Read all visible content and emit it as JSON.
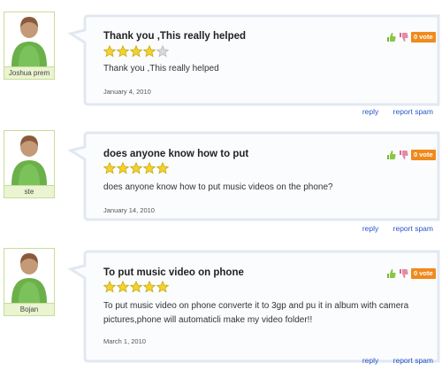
{
  "reviews": [
    {
      "author": "Joshua prem",
      "title": "Thank you ,This really helped",
      "rating": 4,
      "max_rating": 5,
      "body": "Thank you ,This really helped",
      "date": "January 4, 2010",
      "votes": "0 vote"
    },
    {
      "author": "ste",
      "title": "does anyone know how to put",
      "rating": 5,
      "max_rating": 5,
      "body": "does anyone know how to put music videos on the phone?",
      "date": "January 14, 2010",
      "votes": "0 vote"
    },
    {
      "author": "Bojan",
      "title": "To put music video on phone",
      "rating": 5,
      "max_rating": 5,
      "body": "To put music video on phone converte it to 3gp and pu it in album with camera pictures,phone will automaticli make my video folder!!",
      "date": "March 1, 2010",
      "votes": "0 vote"
    }
  ],
  "actions": {
    "reply_label": "reply",
    "spam_label": "report spam"
  },
  "colors": {
    "star_filled": "#f2d22e",
    "star_empty": "#d9d9d9",
    "vote_badge": "#f08a1c",
    "link": "#2a55c8",
    "avatar_border": "#c8dc9a",
    "thumb_up": "#7bb33a",
    "thumb_down": "#d96a8a"
  },
  "icons": {
    "avatar": "person-avatar-icon",
    "thumb_up": "thumbs-up-icon",
    "thumb_down": "thumbs-down-icon",
    "star": "star-icon"
  }
}
